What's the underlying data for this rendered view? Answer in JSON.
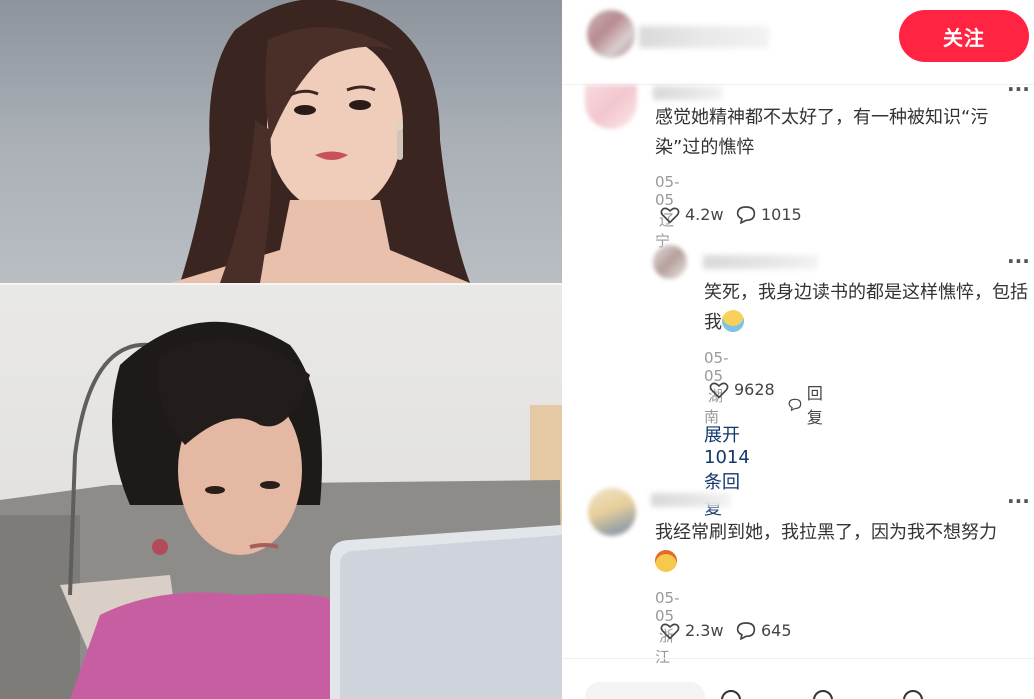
{
  "header": {
    "follow_label": "关注"
  },
  "comments": [
    {
      "text": "感觉她精神都不太好了，有一种被知识“污染”过的憔悴",
      "date": "05-05",
      "location": "辽宁",
      "likes": "4.2w",
      "replies": "1015"
    },
    {
      "text": "笑死，我身边读书的都是这样憔悴，包括我",
      "emoji": "crying-face-emoji",
      "date": "05-05",
      "location": "湖南",
      "likes": "9628",
      "reply_label": "回复"
    },
    {
      "text": "我经常刷到她，我拉黑了，因为我不想努力",
      "emoji": "smiling-face-emoji",
      "date": "05-05",
      "location": "浙江",
      "likes": "2.3w",
      "replies": "645"
    }
  ],
  "expand_replies": "展开 1014 条回复",
  "colors": {
    "accent": "#ff2442",
    "link": "#13386c"
  }
}
